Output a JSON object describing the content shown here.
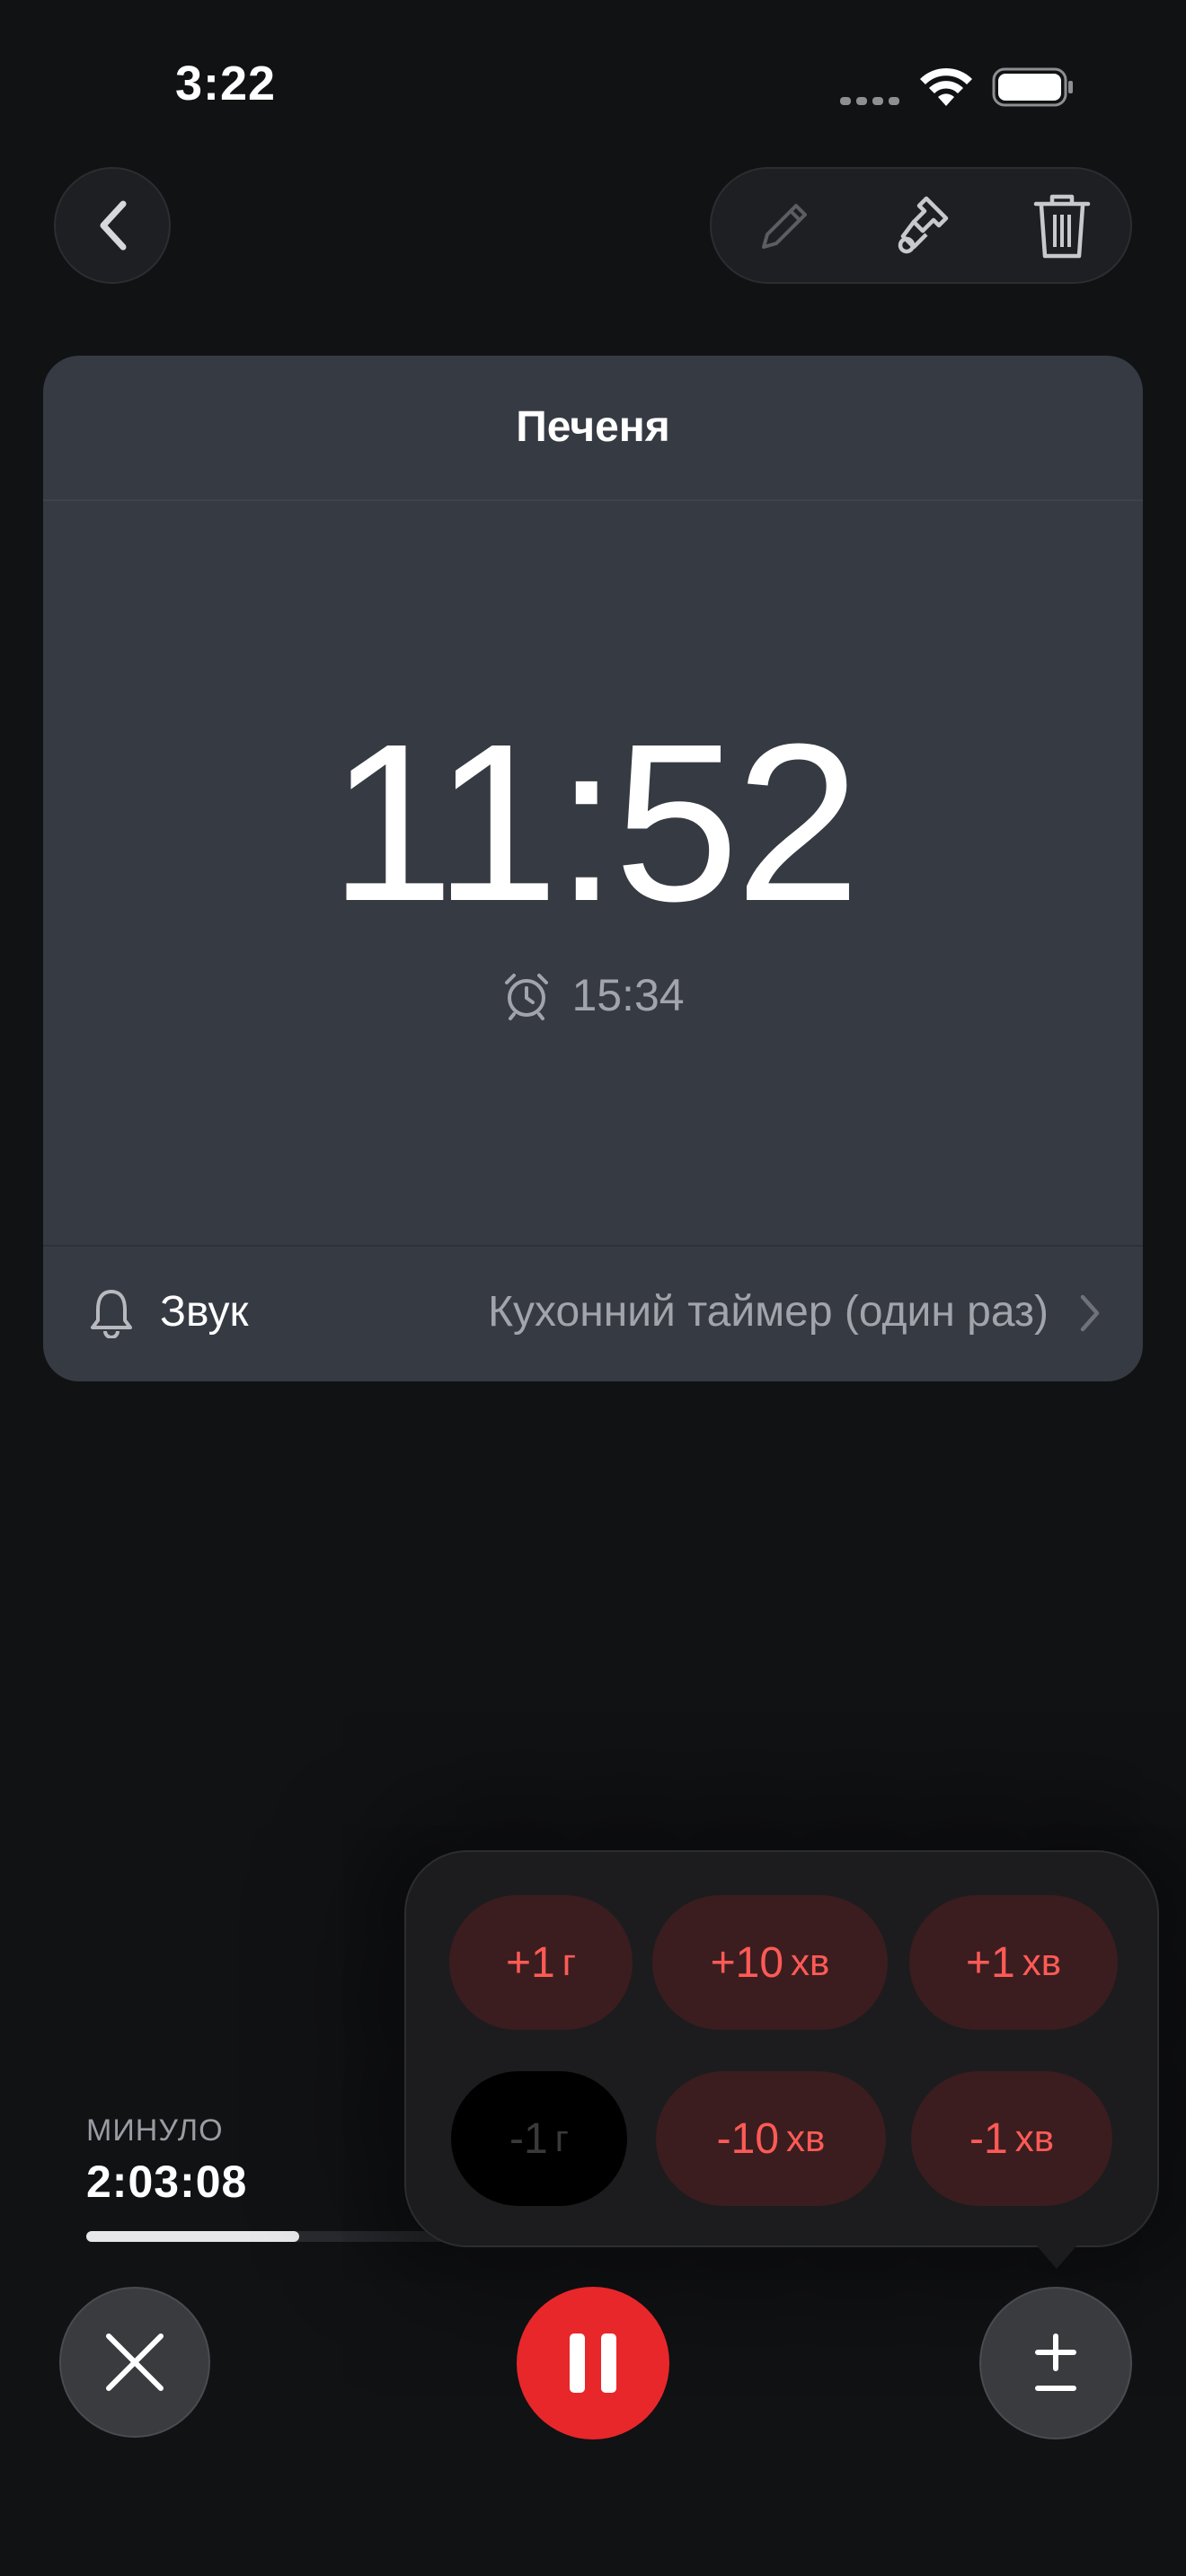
{
  "status_bar": {
    "time": "3:22"
  },
  "timer": {
    "name": "Печеня",
    "remaining": "11:52",
    "ends_at": "15:34",
    "sound_label": "Звук",
    "sound_value": "Кухонний таймер (один раз)"
  },
  "elapsed": {
    "label": "МИНУЛО",
    "value": "2:03:08",
    "progress_fraction": 0.21
  },
  "adjust_menu": {
    "buttons": [
      {
        "value": "+1",
        "unit": "г",
        "enabled": true
      },
      {
        "value": "+10",
        "unit": "хв",
        "enabled": true
      },
      {
        "value": "+1",
        "unit": "хв",
        "enabled": true
      },
      {
        "value": "-1",
        "unit": "г",
        "enabled": false
      },
      {
        "value": "-10",
        "unit": "хв",
        "enabled": true
      },
      {
        "value": "-1",
        "unit": "хв",
        "enabled": true
      }
    ]
  },
  "icons": {
    "back": "chevron-left-icon",
    "edit": "pencil-icon",
    "style": "paintbrush-icon",
    "delete": "trash-icon",
    "alarm": "alarm-clock-icon",
    "sound": "bell-icon",
    "cancel": "xmark-icon",
    "pause": "pause-icon",
    "adjust": "plus-minus-icon"
  },
  "colors": {
    "background": "#111214",
    "card": "#363a43",
    "accent_red": "#e8272b",
    "adjust_text": "#ff5a56",
    "adjust_bg": "#3b1d1f"
  }
}
